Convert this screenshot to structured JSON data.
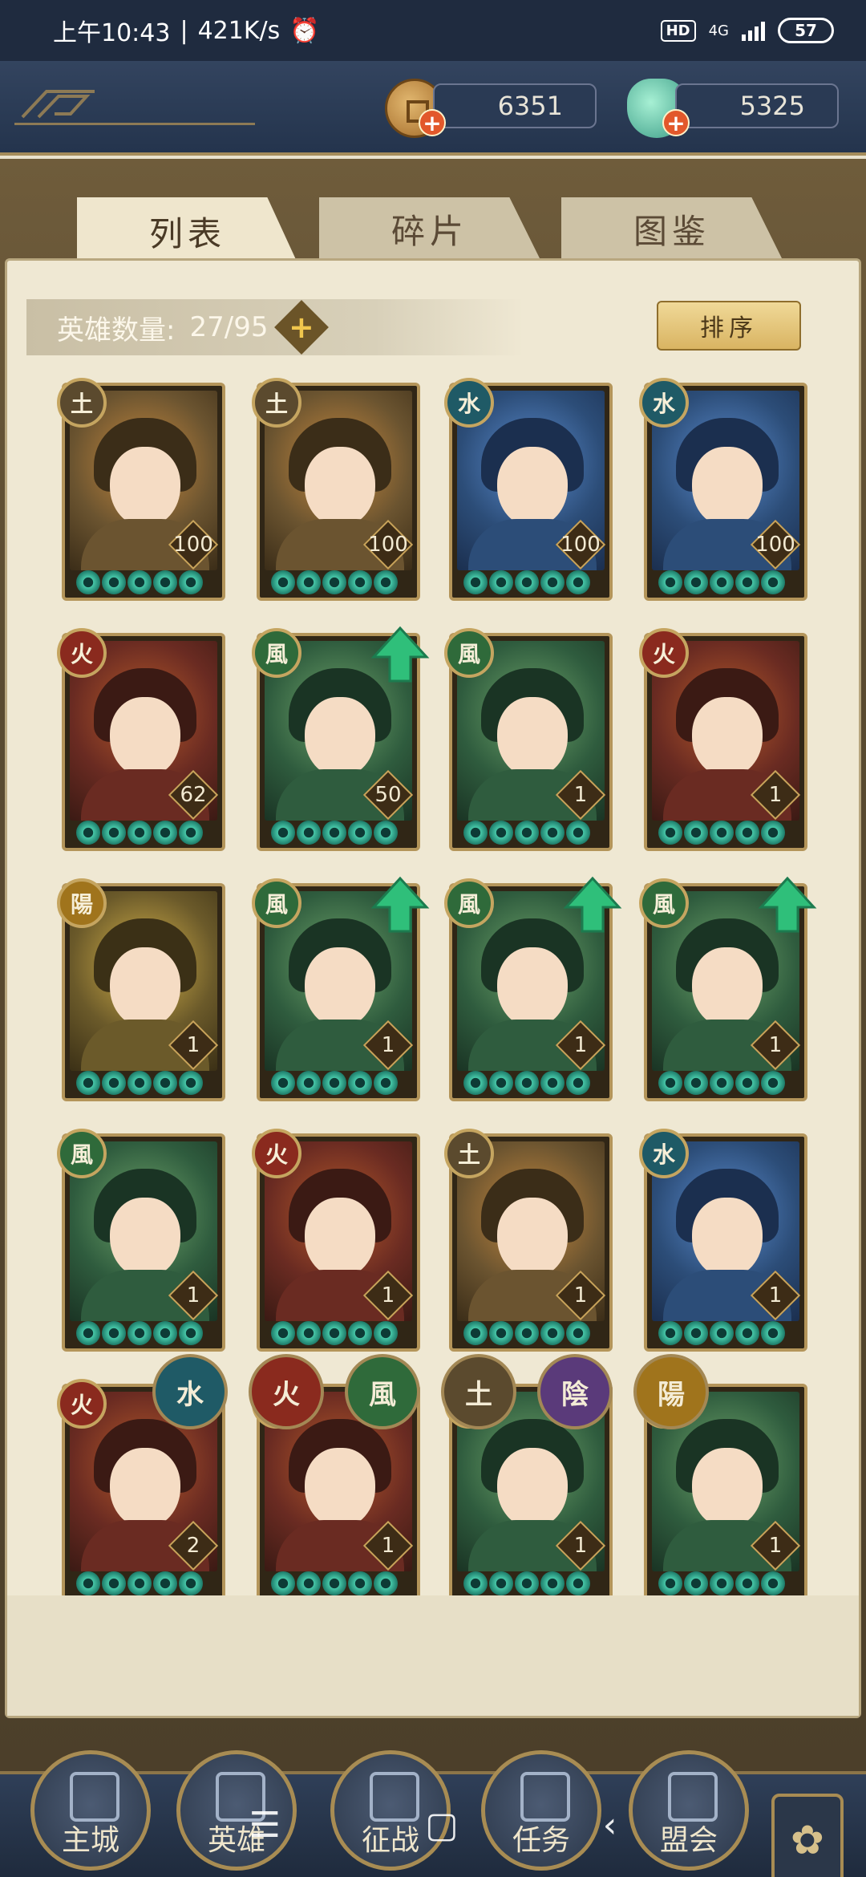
{
  "status_bar": {
    "time": "上午10:43",
    "speed": "421K/s",
    "hd": "HD",
    "network": "4G",
    "battery": "57"
  },
  "resources": {
    "coins": "6351",
    "gems": "5325"
  },
  "tabs": [
    {
      "label": "列表",
      "active": true
    },
    {
      "label": "碎片",
      "active": false
    },
    {
      "label": "图鉴",
      "active": false
    }
  ],
  "hero_count": {
    "label": "英雄数量:",
    "value": "27/95"
  },
  "sort_label": "排序",
  "heroes": [
    {
      "element": "土",
      "level": "100",
      "upgradable": false
    },
    {
      "element": "土",
      "level": "100",
      "upgradable": false
    },
    {
      "element": "水",
      "level": "100",
      "upgradable": false
    },
    {
      "element": "水",
      "level": "100",
      "upgradable": false
    },
    {
      "element": "火",
      "level": "62",
      "upgradable": false
    },
    {
      "element": "風",
      "level": "50",
      "upgradable": true
    },
    {
      "element": "風",
      "level": "1",
      "upgradable": false
    },
    {
      "element": "火",
      "level": "1",
      "upgradable": false
    },
    {
      "element": "陽",
      "level": "1",
      "upgradable": false
    },
    {
      "element": "風",
      "level": "1",
      "upgradable": true
    },
    {
      "element": "風",
      "level": "1",
      "upgradable": true
    },
    {
      "element": "風",
      "level": "1",
      "upgradable": true
    },
    {
      "element": "風",
      "level": "1",
      "upgradable": false
    },
    {
      "element": "火",
      "level": "1",
      "upgradable": false
    },
    {
      "element": "土",
      "level": "1",
      "upgradable": false
    },
    {
      "element": "水",
      "level": "1",
      "upgradable": false
    },
    {
      "element": "火",
      "level": "2",
      "upgradable": false
    },
    {
      "element": "火",
      "level": "1",
      "upgradable": false
    },
    {
      "element": "風",
      "level": "1",
      "upgradable": false
    },
    {
      "element": "風",
      "level": "1",
      "upgradable": false
    }
  ],
  "element_filters": [
    "水",
    "火",
    "風",
    "土",
    "陰",
    "陽"
  ],
  "element_colors": {
    "水": "#1f5a66",
    "火": "#8a2a1e",
    "風": "#2f6a3a",
    "土": "#5b4a2e",
    "陰": "#5a3a7a",
    "陽": "#a0741c"
  },
  "bottom_nav": [
    {
      "label": "主城",
      "icon": "castle-icon"
    },
    {
      "label": "英雄",
      "icon": "hero-icon"
    },
    {
      "label": "征战",
      "icon": "battle-icon"
    },
    {
      "label": "任务",
      "icon": "quest-icon"
    },
    {
      "label": "盟会",
      "icon": "guild-icon"
    }
  ]
}
